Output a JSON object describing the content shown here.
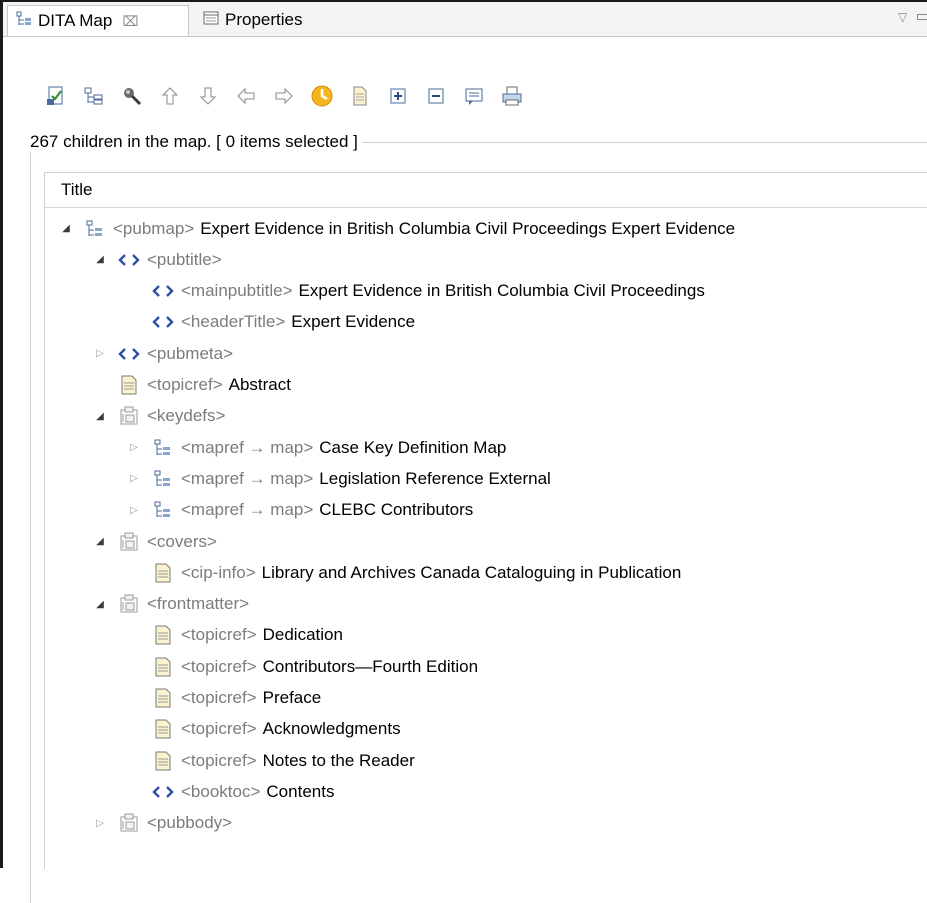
{
  "tabs": {
    "dita_map": {
      "label": "DITA Map",
      "icon": "map-tree-icon",
      "close": "⌧"
    },
    "properties": {
      "label": "Properties",
      "icon": "properties-icon"
    }
  },
  "toolbar": {
    "buttons": [
      "validate-icon",
      "map-structure-icon",
      "search-icon",
      "arrow-up-icon",
      "arrow-down-icon",
      "arrow-left-icon",
      "arrow-right-icon",
      "refresh-icon",
      "page-icon",
      "expand-all-icon",
      "collapse-all-icon",
      "comments-icon",
      "print-icon"
    ]
  },
  "status": {
    "text": "267 children in the map. [ 0 items selected ]"
  },
  "tree": {
    "column_title": "Title",
    "rows": [
      {
        "tag": "<pubmap>",
        "title": "Expert Evidence in British Columbia Civil Proceedings Expert Evidence",
        "icon": "map-icon",
        "toggle": "open"
      },
      {
        "tag": "<pubtitle>",
        "title": "",
        "icon": "element-icon",
        "toggle": "open"
      },
      {
        "tag": "<mainpubtitle>",
        "title": "Expert Evidence in British Columbia Civil Proceedings",
        "icon": "element-icon",
        "toggle": "none"
      },
      {
        "tag": "<headerTitle>",
        "title": "Expert Evidence",
        "icon": "element-icon",
        "toggle": "none"
      },
      {
        "tag": "<pubmeta>",
        "title": "",
        "icon": "element-icon",
        "toggle": "closed"
      },
      {
        "tag": "<topicref>",
        "title": "Abstract",
        "icon": "topic-icon",
        "toggle": "none"
      },
      {
        "tag": "<keydefs>",
        "title": "",
        "icon": "container-icon",
        "toggle": "open"
      },
      {
        "tag": "<mapref → map>",
        "title": "Case Key Definition Map",
        "icon": "map-icon",
        "toggle": "closed"
      },
      {
        "tag": "<mapref → map>",
        "title": "Legislation Reference External",
        "icon": "map-icon",
        "toggle": "closed"
      },
      {
        "tag": "<mapref → map>",
        "title": "CLEBC Contributors",
        "icon": "map-icon",
        "toggle": "closed"
      },
      {
        "tag": "<covers>",
        "title": "",
        "icon": "container-icon",
        "toggle": "open"
      },
      {
        "tag": "<cip-info>",
        "title": "Library and Archives Canada Cataloguing in Publication",
        "icon": "topic-icon",
        "toggle": "none"
      },
      {
        "tag": "<frontmatter>",
        "title": "",
        "icon": "container-icon",
        "toggle": "open"
      },
      {
        "tag": "<topicref>",
        "title": "Dedication",
        "icon": "topic-icon",
        "toggle": "none"
      },
      {
        "tag": "<topicref>",
        "title": "Contributors—Fourth Edition",
        "icon": "topic-icon",
        "toggle": "none"
      },
      {
        "tag": "<topicref>",
        "title": "Preface",
        "icon": "topic-icon",
        "toggle": "none"
      },
      {
        "tag": "<topicref>",
        "title": "Acknowledgments",
        "icon": "topic-icon",
        "toggle": "none"
      },
      {
        "tag": "<topicref>",
        "title": "Notes to the Reader",
        "icon": "topic-icon",
        "toggle": "none"
      },
      {
        "tag": "<booktoc>",
        "title": "Contents",
        "icon": "element-icon",
        "toggle": "none"
      },
      {
        "tag": "<pubbody>",
        "title": "",
        "icon": "container-icon",
        "toggle": "closed"
      }
    ]
  }
}
